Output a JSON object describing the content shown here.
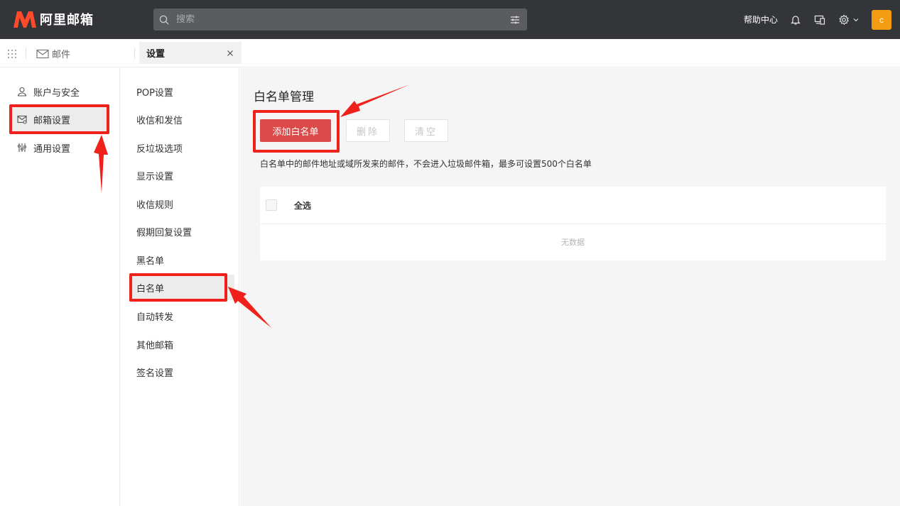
{
  "header": {
    "logo_text": "阿里邮箱",
    "search_placeholder": "搜索",
    "help_label": "帮助中心",
    "avatar_letter": "c"
  },
  "tabs": {
    "mail_label": "邮件",
    "settings_label": "设置"
  },
  "sidebar": {
    "items": [
      {
        "label": "账户与安全",
        "icon": "user-icon"
      },
      {
        "label": "邮箱设置",
        "icon": "mailbox-settings-icon",
        "active": true
      },
      {
        "label": "通用设置",
        "icon": "sliders-icon"
      }
    ]
  },
  "submenu": {
    "items": [
      {
        "label": "POP设置"
      },
      {
        "label": "收信和发信"
      },
      {
        "label": "反垃圾选项"
      },
      {
        "label": "显示设置"
      },
      {
        "label": "收信规则"
      },
      {
        "label": "假期回复设置"
      },
      {
        "label": "黑名单"
      },
      {
        "label": "白名单",
        "active": true
      },
      {
        "label": "自动转发"
      },
      {
        "label": "其他邮箱"
      },
      {
        "label": "签名设置"
      }
    ]
  },
  "main": {
    "title": "白名单管理",
    "add_button": "添加白名单",
    "delete_button": "删除",
    "clear_button": "清空",
    "description": "白名单中的邮件地址或域所发来的邮件，不会进入垃圾邮件箱，最多可设置500个白名单",
    "table": {
      "select_all_label": "全选",
      "empty_text": "无数据"
    }
  },
  "colors": {
    "topbar": "#333538",
    "primary_button": "#dd4848",
    "annotation_red": "#f0201a",
    "avatar": "#f39c12"
  }
}
